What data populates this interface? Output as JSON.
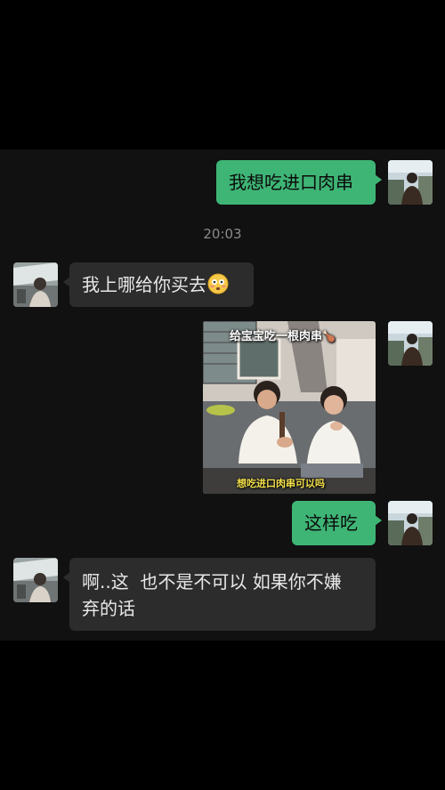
{
  "messages": [
    {
      "side": "sent",
      "text": "我想吃进口肉串"
    },
    {
      "side": "received",
      "text": "我上哪给你买去"
    },
    {
      "side": "sent",
      "type": "image",
      "caption_top": "给宝宝吃一根肉串",
      "caption_bottom": "想吃进口肉串可以吗"
    },
    {
      "side": "sent",
      "text": "这样吃"
    },
    {
      "side": "received",
      "text_line1": "啊..这  也不是不可以 如果你不嫌",
      "text_line2": "弃的话"
    }
  ],
  "timestamp": "20:03",
  "icons": {
    "emoji": "flushed-face-icon",
    "caption_emoji": "drumstick-icon"
  },
  "colors": {
    "background": "#000000",
    "chat_background": "#111111",
    "sent_bubble": "#3eb575",
    "received_bubble": "#2c2c2c",
    "timestamp": "#8a8a8a"
  }
}
